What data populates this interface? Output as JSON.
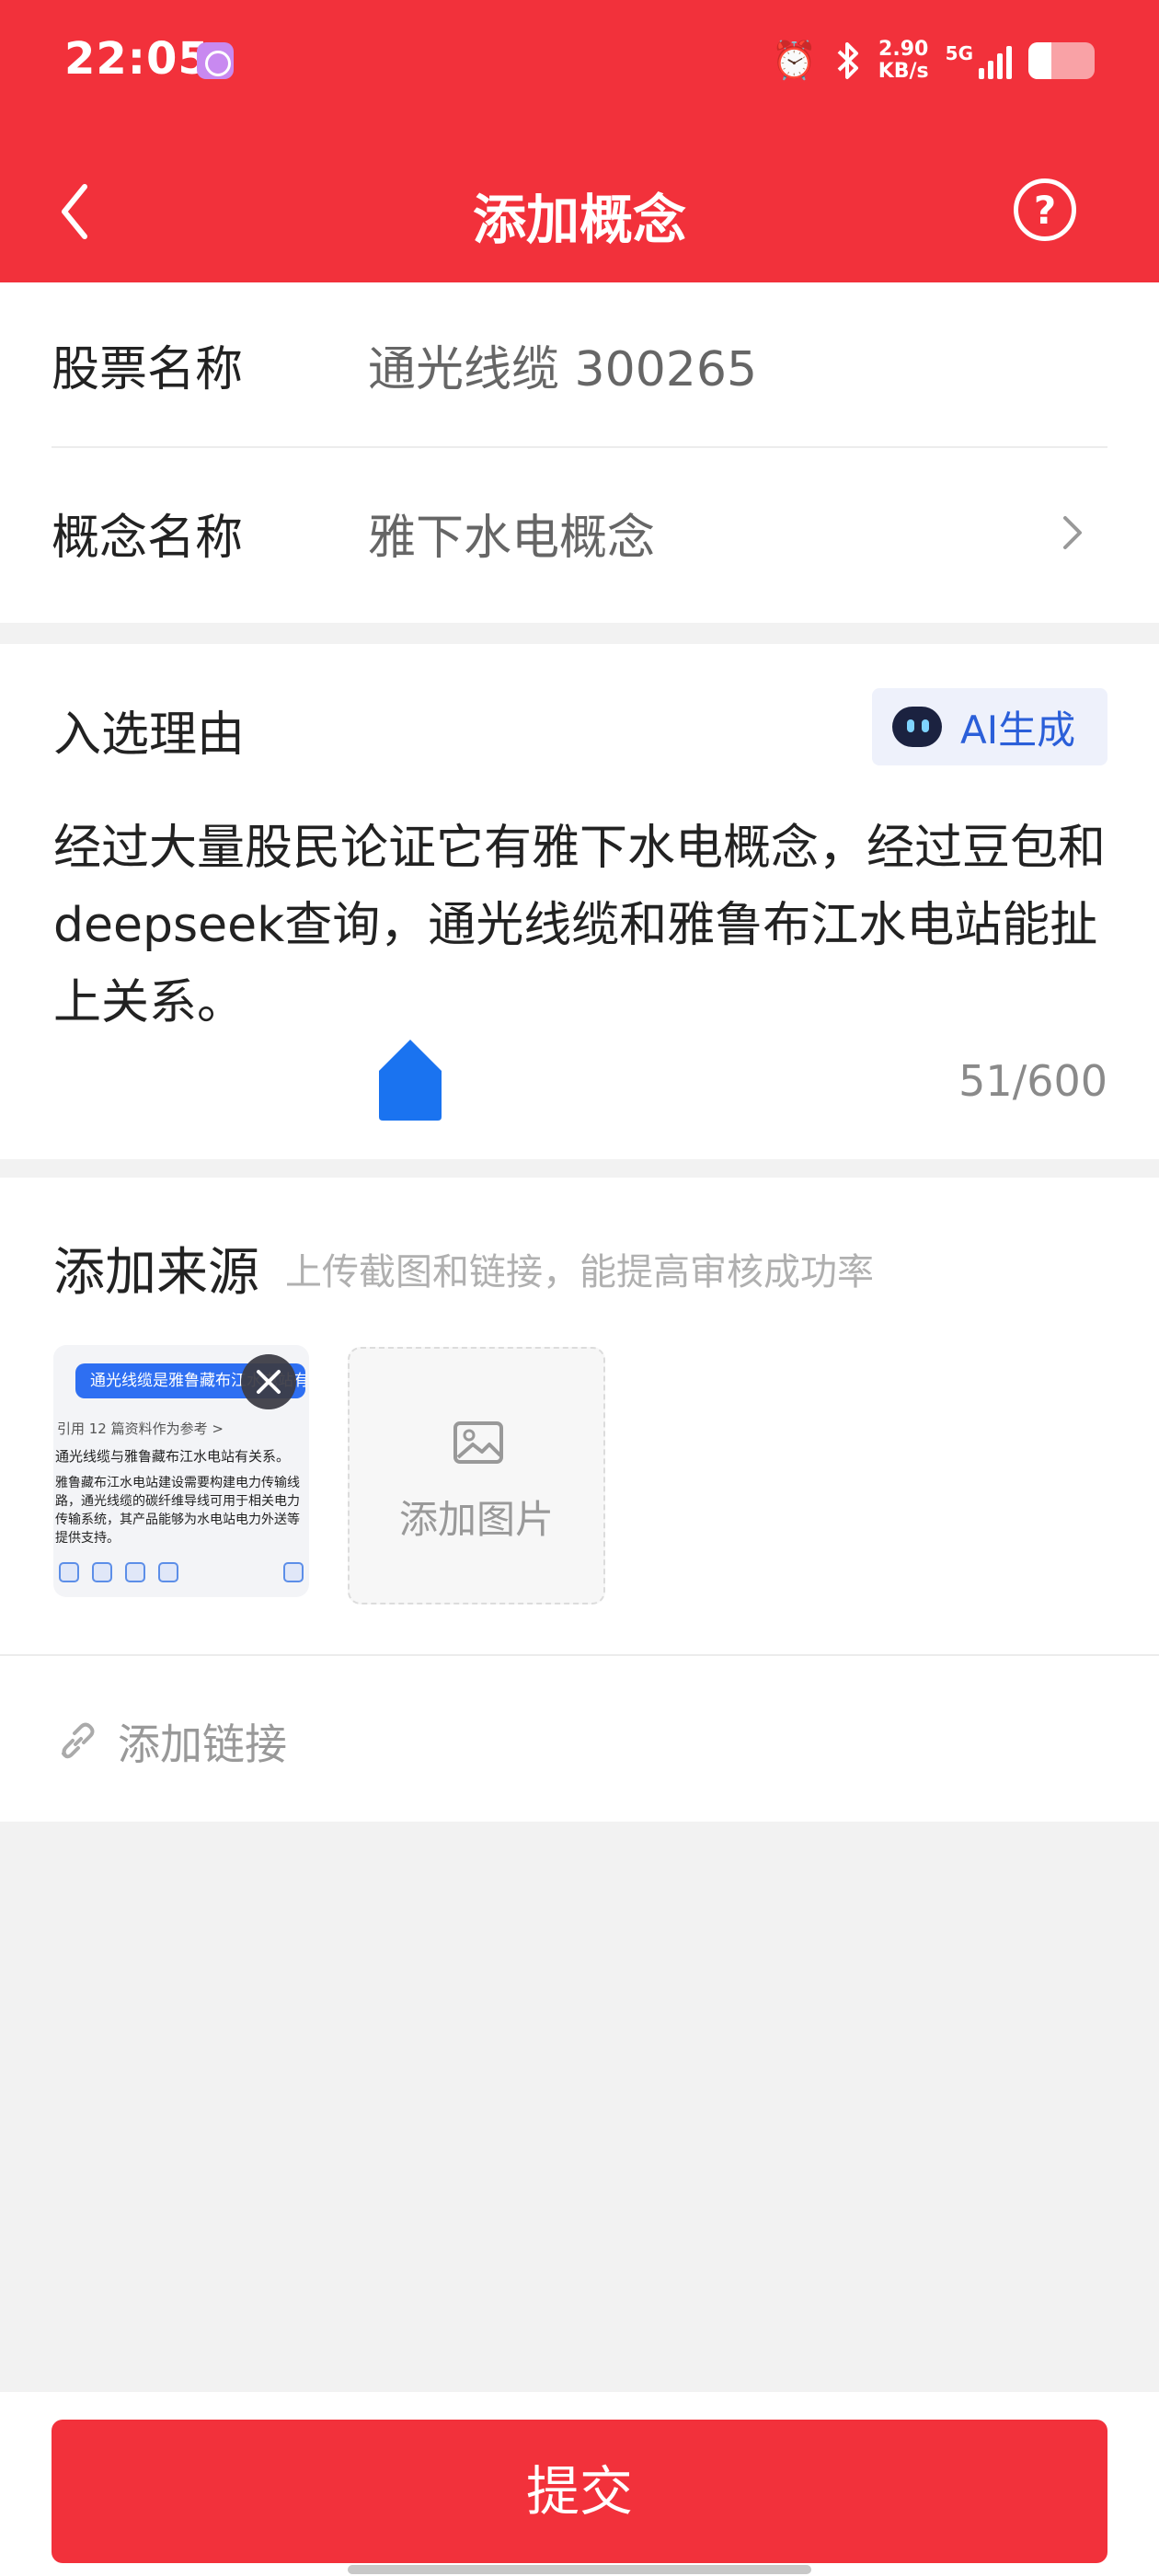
{
  "status_bar": {
    "time": "22:05",
    "net_speed_value": "2.90",
    "net_speed_unit": "KB/s",
    "network_type": "5G",
    "battery_level": 0.35
  },
  "header": {
    "title": "添加概念",
    "help_symbol": "?"
  },
  "form": {
    "stock_label": "股票名称",
    "stock_value": "通光线缆 300265",
    "concept_label": "概念名称",
    "concept_value": "雅下水电概念"
  },
  "reason": {
    "label": "入选理由",
    "ai_button": "AI生成",
    "text": "经过大量股民论证它有雅下水电概念，经过豆包和deepseek查询，通光线缆和雅鲁布江水电站能扯上关系。",
    "counter": "51/600"
  },
  "source": {
    "label": "添加来源",
    "hint": "上传截图和链接，能提高审核成功率",
    "thumbnail": {
      "question": "通光线缆是雅鲁藏布江水电站有关系吗",
      "reference": "引用 12 篇资料作为参考 >",
      "line1": "通光线缆与雅鲁藏布江水电站有关系。",
      "body": "雅鲁藏布江水电站建设需要构建电力传输线路，通光线缆的碳纤维导线可用于相关电力传输系统，其产品能够为水电站电力外送等提供支持。"
    },
    "add_image_label": "添加图片",
    "add_link_label": "添加链接"
  },
  "footer": {
    "submit": "提交"
  },
  "colors": {
    "brand_red": "#f2313b",
    "ai_blue": "#2b5fd9",
    "cursor_blue": "#1a73f0"
  }
}
